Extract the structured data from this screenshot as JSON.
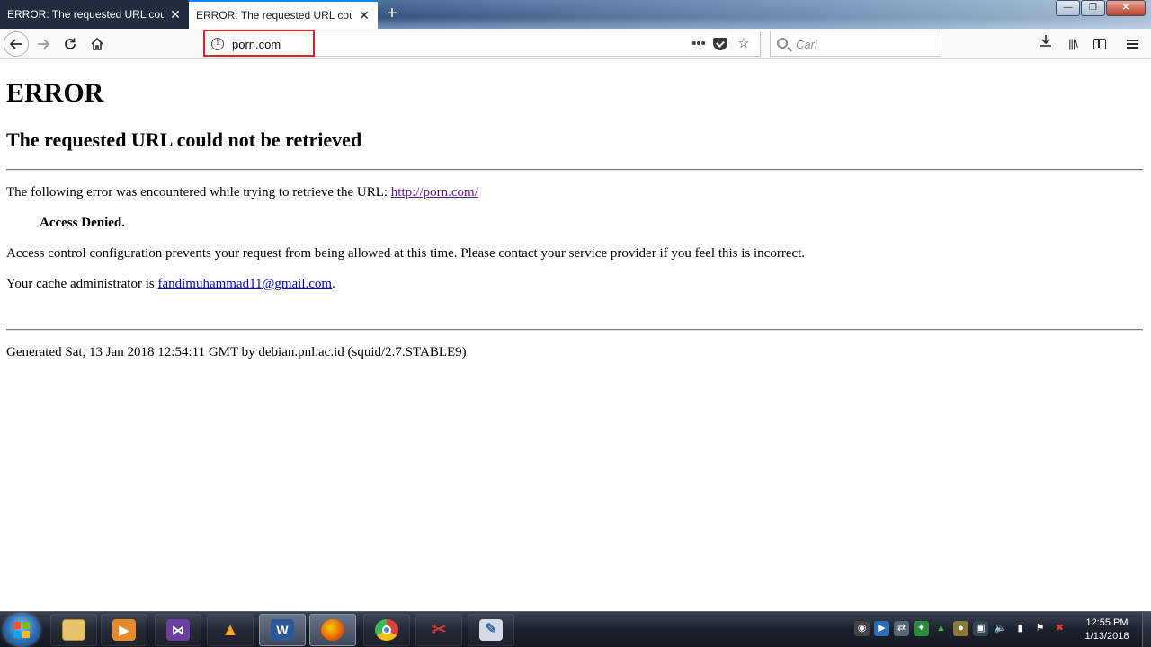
{
  "browser": {
    "tabs": [
      {
        "title": "ERROR: The requested URL could n",
        "active": false
      },
      {
        "title": "ERROR: The requested URL could n",
        "active": true
      }
    ],
    "url": "porn.com",
    "search_placeholder": "Cari"
  },
  "page": {
    "h1": "ERROR",
    "h2": "The requested URL could not be retrieved",
    "p1_prefix": "The following error was encountered while trying to retrieve the URL: ",
    "p1_link": "http://porn.com/",
    "denied": "Access Denied.",
    "p2": "Access control configuration prevents your request from being allowed at this time. Please contact your service provider if you feel this is incorrect.",
    "p3_prefix": "Your cache administrator is ",
    "p3_link": "fandimuhammad11@gmail.com",
    "p3_suffix": ".",
    "footer": "Generated Sat, 13 Jan 2018 12:54:11 GMT by debian.pnl.ac.id (squid/2.7.STABLE9)"
  },
  "taskbar": {
    "apps": [
      {
        "name": "file-explorer",
        "color": "#e8c36a",
        "glyph": ""
      },
      {
        "name": "media-player",
        "color": "#e88a2a",
        "glyph": "▶"
      },
      {
        "name": "visual-studio",
        "color": "#6b3fa0",
        "glyph": "⋈"
      },
      {
        "name": "alert-app",
        "color": "#f2a81d",
        "glyph": "▲"
      },
      {
        "name": "word",
        "color": "#2b5797",
        "glyph": "W"
      },
      {
        "name": "firefox",
        "color": "#e66000",
        "glyph": "●"
      },
      {
        "name": "chrome",
        "color": "#3cba54",
        "glyph": "◉"
      },
      {
        "name": "snipping-tool",
        "color": "#c0c7d2",
        "glyph": "✂"
      },
      {
        "name": "paint",
        "color": "#d2dbe6",
        "glyph": "🖌"
      }
    ],
    "time": "12:55 PM",
    "date": "1/13/2018"
  },
  "colors": {
    "tab_accent": "#0a84ff",
    "visited_link": "#551a8b",
    "link": "#0000ee",
    "url_highlight": "#e02020"
  }
}
